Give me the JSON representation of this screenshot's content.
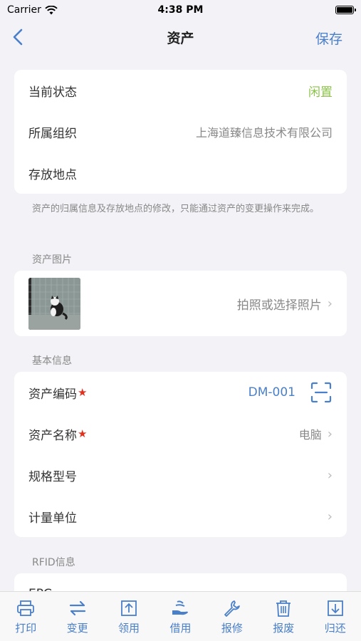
{
  "status_bar": {
    "carrier": "Carrier",
    "time": "4:38 PM"
  },
  "nav": {
    "title": "资产",
    "save_label": "保存"
  },
  "ownership": {
    "rows": [
      {
        "label": "当前状态",
        "value": "闲置",
        "value_color": "#8bc34a"
      },
      {
        "label": "所属组织",
        "value": "上海道臻信息技术有限公司"
      },
      {
        "label": "存放地点",
        "value": ""
      }
    ],
    "note": "资产的归属信息及存放地点的修改，只能通过资产的变更操作来完成。"
  },
  "photo": {
    "section_title": "资产图片",
    "action_label": "拍照或选择照片"
  },
  "basic": {
    "section_title": "基本信息",
    "rows": [
      {
        "label": "资产编码",
        "required": "★",
        "value": "DM-001"
      },
      {
        "label": "资产名称",
        "required": "★",
        "value": "电脑"
      },
      {
        "label": "规格型号",
        "value": ""
      },
      {
        "label": "计量单位",
        "value": ""
      }
    ]
  },
  "rfid": {
    "section_title": "RFID信息",
    "first_row_label": "EPC"
  },
  "tabs": [
    {
      "label": "打印",
      "icon": "printer-icon"
    },
    {
      "label": "变更",
      "icon": "swap-icon"
    },
    {
      "label": "领用",
      "icon": "upload-box-icon"
    },
    {
      "label": "借用",
      "icon": "hand-icon"
    },
    {
      "label": "报修",
      "icon": "wrench-icon"
    },
    {
      "label": "报废",
      "icon": "trash-icon"
    },
    {
      "label": "归还",
      "icon": "download-box-icon"
    }
  ],
  "colors": {
    "accent": "#4a7fc9",
    "status_idle": "#8bc34a",
    "required": "#e0301e"
  }
}
